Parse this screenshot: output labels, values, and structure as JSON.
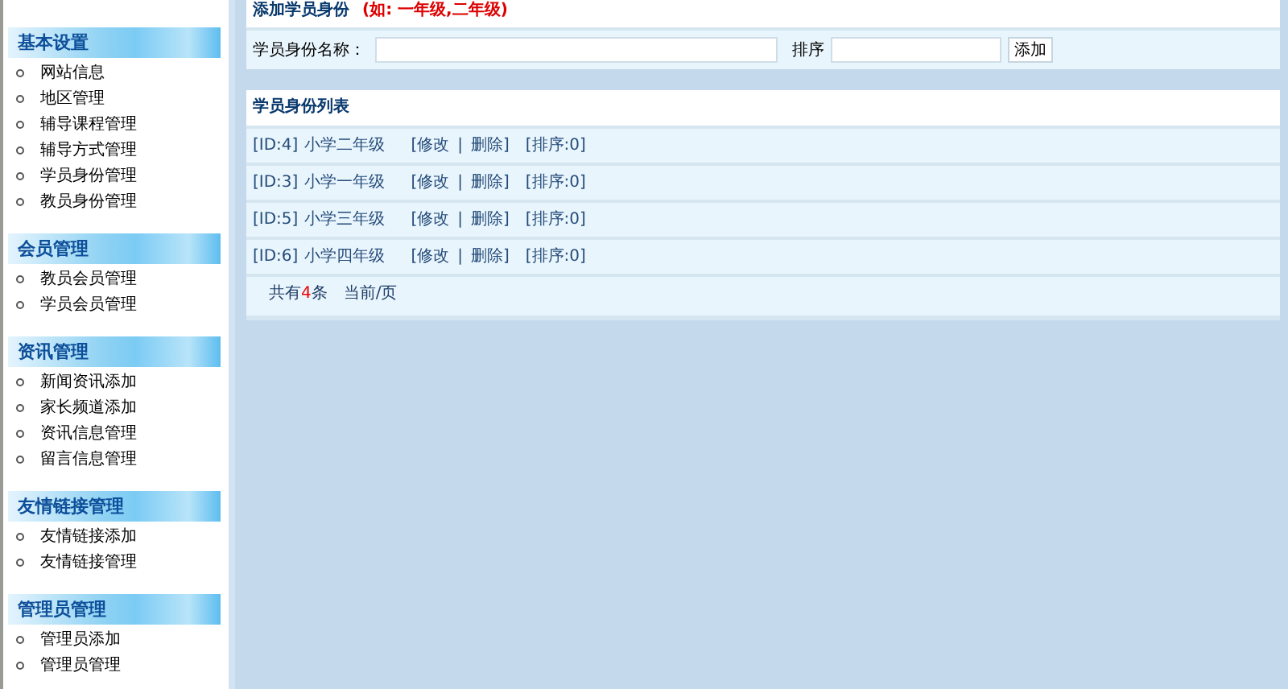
{
  "sidebar": {
    "sections": [
      {
        "title": "基本设置",
        "items": [
          "网站信息",
          "地区管理",
          "辅导课程管理",
          "辅导方式管理",
          "学员身份管理",
          "教员身份管理"
        ]
      },
      {
        "title": "会员管理",
        "items": [
          "教员会员管理",
          "学员会员管理"
        ]
      },
      {
        "title": "资讯管理",
        "items": [
          "新闻资讯添加",
          "家长频道添加",
          "资讯信息管理",
          "留言信息管理"
        ]
      },
      {
        "title": "友情链接管理",
        "items": [
          "友情链接添加",
          "友情链接管理"
        ]
      },
      {
        "title": "管理员管理",
        "items": [
          "管理员添加",
          "管理员管理"
        ]
      }
    ]
  },
  "add_panel": {
    "title": "添加学员身份",
    "hint": "(如: 一年级,二年级)",
    "name_label": "学员身份名称：",
    "sort_label": "排序",
    "submit": "添加"
  },
  "list_panel": {
    "title": "学员身份列表",
    "rows": [
      {
        "id": "[ID:4]",
        "name": "小学二年级",
        "edit": "[修改",
        "sep": "|",
        "delete": "删除]",
        "sort": "[排序:0]"
      },
      {
        "id": "[ID:3]",
        "name": "小学一年级",
        "edit": "[修改",
        "sep": "|",
        "delete": "删除]",
        "sort": "[排序:0]"
      },
      {
        "id": "[ID:5]",
        "name": "小学三年级",
        "edit": "[修改",
        "sep": "|",
        "delete": "删除]",
        "sort": "[排序:0]"
      },
      {
        "id": "[ID:6]",
        "name": "小学四年级",
        "edit": "[修改",
        "sep": "|",
        "delete": "删除]",
        "sort": "[排序:0]"
      }
    ],
    "footer": {
      "total_prefix": "共有",
      "total_count": "4",
      "total_suffix": "条",
      "page": "当前/页"
    }
  }
}
